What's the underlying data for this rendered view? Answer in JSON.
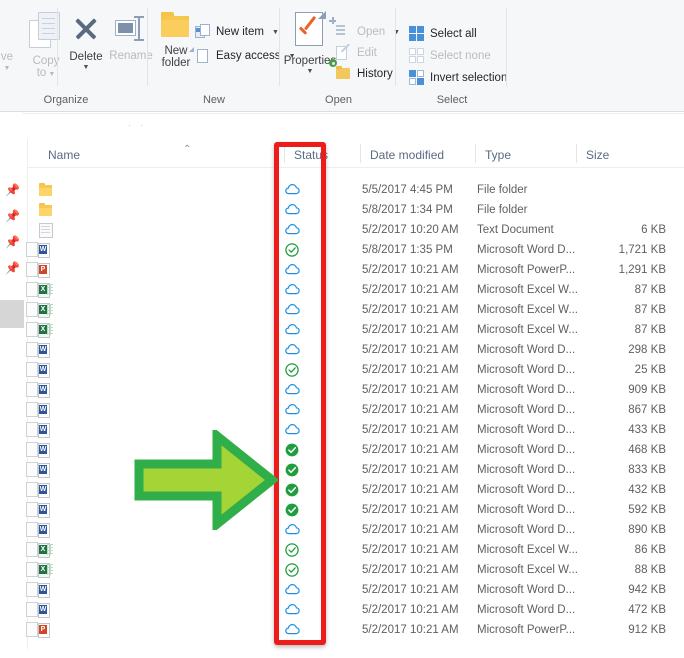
{
  "ribbon": {
    "groups": [
      {
        "name": "Organize",
        "label": "Organize"
      },
      {
        "name": "New",
        "label": "New"
      },
      {
        "name": "Open",
        "label": "Open"
      },
      {
        "name": "Select",
        "label": "Select"
      }
    ],
    "organize": {
      "move_to_label": "ve",
      "copy_to_label_1": "Copy",
      "copy_to_label_2": "to",
      "delete_label": "Delete",
      "rename_label": "Rename"
    },
    "new_group": {
      "new_folder_label_1": "New",
      "new_folder_label_2": "folder",
      "new_item_label": "New item",
      "easy_access_label": "Easy access"
    },
    "open_group": {
      "properties_label": "Properties",
      "open_label": "Open",
      "edit_label": "Edit",
      "history_label": "History"
    },
    "select_group": {
      "select_all_label": "Select all",
      "select_none_label": "Select none",
      "invert_selection_label": "Invert selection"
    }
  },
  "columns": {
    "name": "Name",
    "status": "Status",
    "date_modified": "Date modified",
    "type": "Type",
    "size": "Size",
    "sort_caret": "⌃"
  },
  "files": [
    {
      "icon": "folder",
      "status": "cloud-online-only",
      "date": "5/5/2017 4:45 PM",
      "type": "File folder",
      "size": ""
    },
    {
      "icon": "folder",
      "status": "cloud-online-only",
      "date": "5/8/2017 1:34 PM",
      "type": "File folder",
      "size": ""
    },
    {
      "icon": "txt",
      "status": "cloud-online-only",
      "date": "5/2/2017 10:20 AM",
      "type": "Text Document",
      "size": "6 KB"
    },
    {
      "icon": "word",
      "status": "check-outline",
      "date": "5/8/2017 1:35 PM",
      "type": "Microsoft Word D...",
      "size": "1,721 KB"
    },
    {
      "icon": "ppt",
      "status": "cloud-online-only",
      "date": "5/2/2017 10:21 AM",
      "type": "Microsoft PowerP...",
      "size": "1,291 KB"
    },
    {
      "icon": "excel",
      "status": "cloud-online-only",
      "date": "5/2/2017 10:21 AM",
      "type": "Microsoft Excel W...",
      "size": "87 KB"
    },
    {
      "icon": "excel",
      "status": "cloud-online-only",
      "date": "5/2/2017 10:21 AM",
      "type": "Microsoft Excel W...",
      "size": "87 KB"
    },
    {
      "icon": "excel",
      "status": "cloud-online-only",
      "date": "5/2/2017 10:21 AM",
      "type": "Microsoft Excel W...",
      "size": "87 KB"
    },
    {
      "icon": "word",
      "status": "cloud-online-only",
      "date": "5/2/2017 10:21 AM",
      "type": "Microsoft Word D...",
      "size": "298 KB"
    },
    {
      "icon": "word",
      "status": "check-outline",
      "date": "5/2/2017 10:21 AM",
      "type": "Microsoft Word D...",
      "size": "25 KB"
    },
    {
      "icon": "word",
      "status": "cloud-online-only",
      "date": "5/2/2017 10:21 AM",
      "type": "Microsoft Word D...",
      "size": "909 KB"
    },
    {
      "icon": "word",
      "status": "cloud-online-only",
      "date": "5/2/2017 10:21 AM",
      "type": "Microsoft Word D...",
      "size": "867 KB"
    },
    {
      "icon": "word",
      "status": "cloud-online-only",
      "date": "5/2/2017 10:21 AM",
      "type": "Microsoft Word D...",
      "size": "433 KB"
    },
    {
      "icon": "word",
      "status": "check-solid",
      "date": "5/2/2017 10:21 AM",
      "type": "Microsoft Word D...",
      "size": "468 KB"
    },
    {
      "icon": "word",
      "status": "check-solid",
      "date": "5/2/2017 10:21 AM",
      "type": "Microsoft Word D...",
      "size": "833 KB"
    },
    {
      "icon": "word",
      "status": "check-solid",
      "date": "5/2/2017 10:21 AM",
      "type": "Microsoft Word D...",
      "size": "432 KB"
    },
    {
      "icon": "word",
      "status": "check-solid",
      "date": "5/2/2017 10:21 AM",
      "type": "Microsoft Word D...",
      "size": "592 KB"
    },
    {
      "icon": "word",
      "status": "cloud-online-only",
      "date": "5/2/2017 10:21 AM",
      "type": "Microsoft Word D...",
      "size": "890 KB"
    },
    {
      "icon": "excel",
      "status": "check-outline",
      "date": "5/2/2017 10:21 AM",
      "type": "Microsoft Excel W...",
      "size": "86 KB"
    },
    {
      "icon": "excel",
      "status": "check-outline",
      "date": "5/2/2017 10:21 AM",
      "type": "Microsoft Excel W...",
      "size": "88 KB"
    },
    {
      "icon": "word",
      "status": "cloud-online-only",
      "date": "5/2/2017 10:21 AM",
      "type": "Microsoft Word D...",
      "size": "942 KB"
    },
    {
      "icon": "word",
      "status": "cloud-online-only",
      "date": "5/2/2017 10:21 AM",
      "type": "Microsoft Word D...",
      "size": "472 KB"
    },
    {
      "icon": "ppt",
      "status": "cloud-online-only",
      "date": "5/2/2017 10:21 AM",
      "type": "Microsoft PowerP...",
      "size": "912 KB"
    }
  ],
  "annotations": {
    "highlight_box_color": "#ee1b1b",
    "arrow_fill_color": "#a5d436",
    "arrow_border_color": "#2fae4a"
  },
  "theme": {
    "ribbon_background": "#f6f7f8",
    "header_text_color": "#5a6b82",
    "cloud_icon_color": "#1a8fe3",
    "check_color": "#1f9d3f"
  }
}
